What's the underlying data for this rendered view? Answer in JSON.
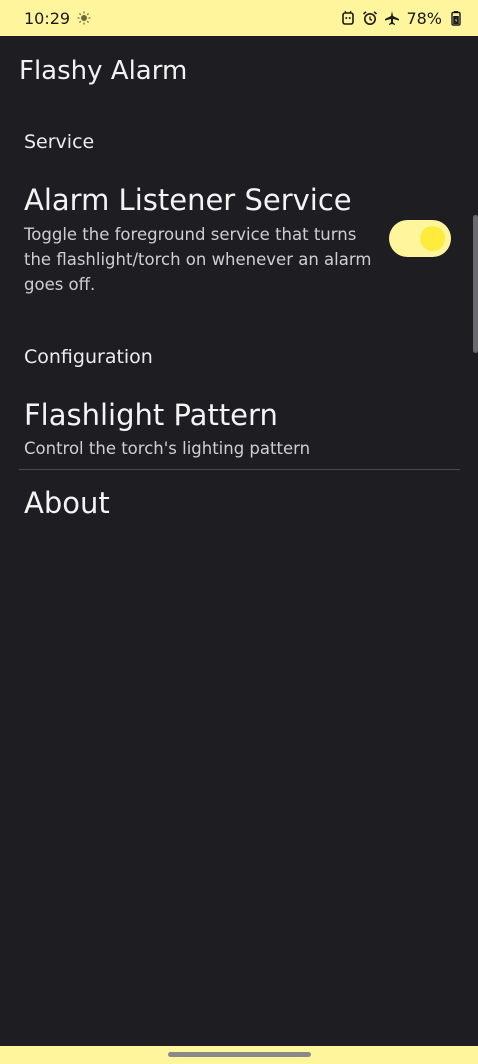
{
  "status_bar": {
    "time": "10:29",
    "battery_percent": "78%",
    "icons": [
      "brightness-icon",
      "android-icon",
      "alarm-icon",
      "airplane-icon",
      "battery-icon"
    ],
    "background": "#fff59d"
  },
  "app": {
    "title": "Flashy Alarm"
  },
  "sections": {
    "service": {
      "header": "Service",
      "alarm_listener": {
        "title": "Alarm Listener Service",
        "summary": "Toggle the foreground service that turns the flashlight/torch on whenever an alarm goes off.",
        "enabled": true
      }
    },
    "configuration": {
      "header": "Configuration",
      "flashlight_pattern": {
        "title": "Flashlight Pattern",
        "summary": "Control the torch's lighting pattern"
      },
      "about": {
        "title": "About"
      }
    }
  },
  "colors": {
    "background": "#1e1e22",
    "accent": "#ffeb3b",
    "switch_track": "#fff59d"
  }
}
